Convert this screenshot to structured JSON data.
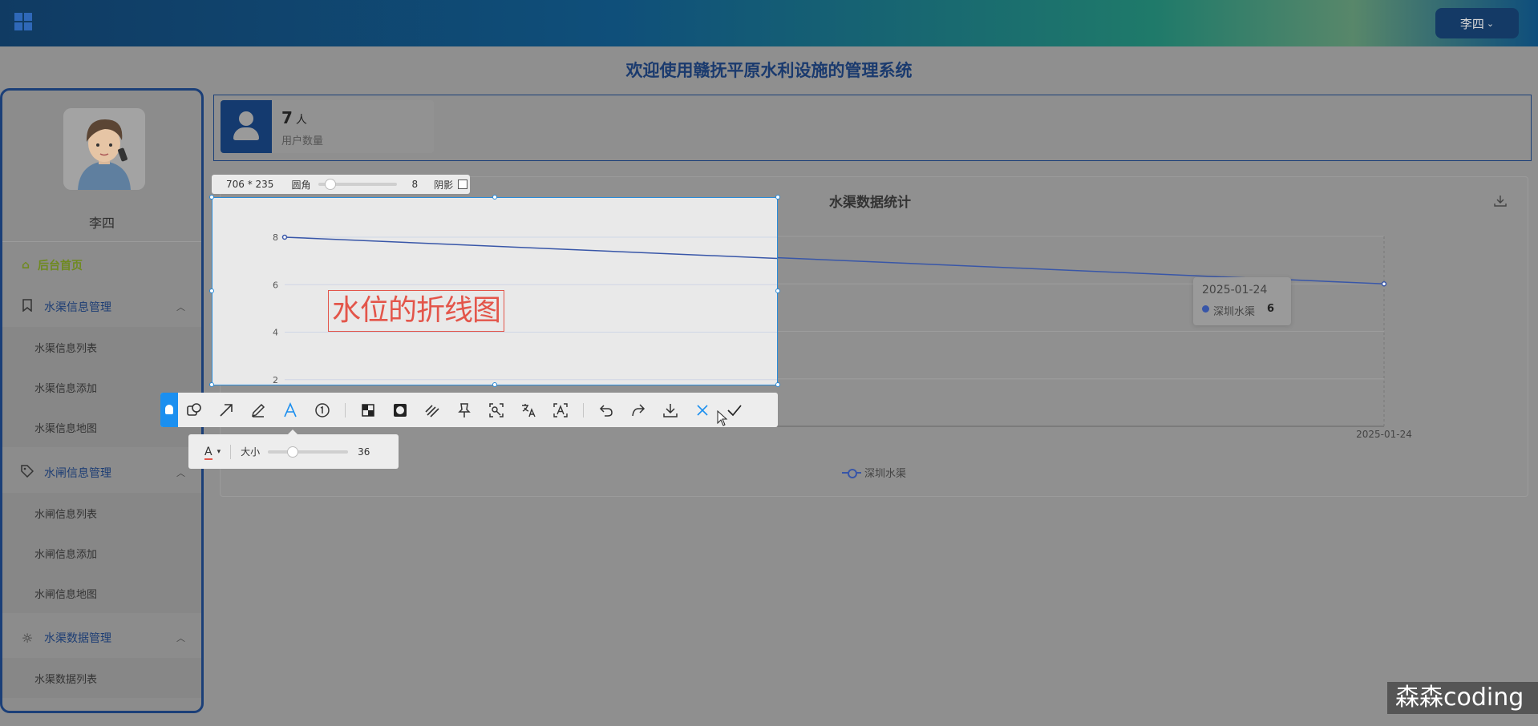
{
  "header": {
    "user_menu_label": "李四"
  },
  "page_title": "欢迎使用赣抚平原水利设施的管理系统",
  "sidebar": {
    "username": "李四",
    "home_label": "后台首页",
    "groups": [
      {
        "label": "水渠信息管理",
        "icon": "bookmark-icon",
        "items": [
          "水渠信息列表",
          "水渠信息添加",
          "水渠信息地图"
        ]
      },
      {
        "label": "水闸信息管理",
        "icon": "tag-icon",
        "items": [
          "水闸信息列表",
          "水闸信息添加",
          "水闸信息地图"
        ]
      },
      {
        "label": "水渠数据管理",
        "icon": "sun-icon",
        "items": [
          "水渠数据列表"
        ]
      }
    ]
  },
  "stats": {
    "value": "7",
    "unit": "人",
    "label": "用户数量"
  },
  "chart": {
    "title": "水渠数据统计",
    "tooltip": {
      "date": "2025-01-24",
      "series": "深圳水渠",
      "value": "6"
    },
    "x_labels": [
      "2025-01-24",
      "2025-01-24"
    ],
    "y_ticks": [
      "8",
      "6",
      "4",
      "2"
    ],
    "legend": "深圳水渠"
  },
  "chart_data": {
    "type": "line",
    "title": "水渠数据统计",
    "categories": [
      "2025-01-24",
      "2025-01-24"
    ],
    "series": [
      {
        "name": "深圳水渠",
        "values": [
          8,
          6
        ]
      }
    ],
    "ylim": [
      0,
      8
    ],
    "legend_position": "bottom"
  },
  "screenshot_tool": {
    "size_text": "706 * 235",
    "radius_label": "圆角",
    "radius_value": "8",
    "shadow_label": "阴影",
    "annotation_text": "水位的折线图",
    "text_size_label": "大小",
    "text_size_value": "36",
    "text_color_glyph": "A",
    "annotation_color": "#e3554a",
    "accent_color": "#1b8fef"
  },
  "watermark": "森森coding"
}
